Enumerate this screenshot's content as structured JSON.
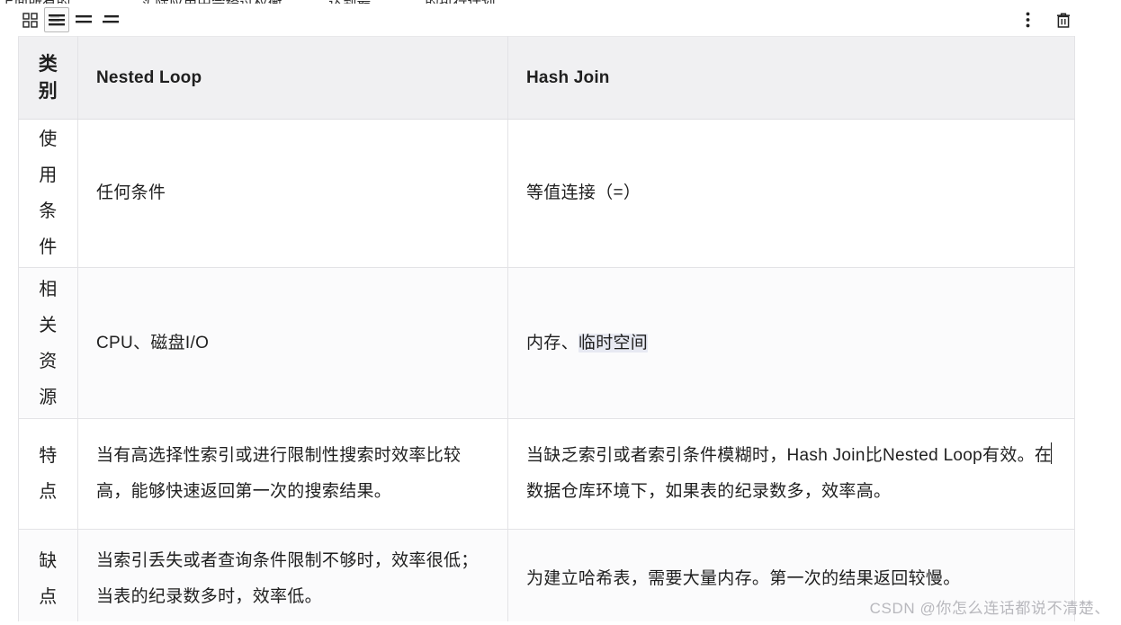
{
  "top_clipped_line": {
    "fragment_1": "上面所有的",
    "fragment_2": "实际应用中会经过权衡",
    "fragment_3": "，达到最",
    "fragment_4": "的执行计划。"
  },
  "toolbar": {
    "left_buttons": [
      {
        "name": "grid-view",
        "icon": "grid-icon",
        "active": false,
        "tooltip": "网格"
      },
      {
        "name": "align-left",
        "icon": "align-left-icon",
        "active": true,
        "tooltip": "左对齐"
      },
      {
        "name": "align-center",
        "icon": "align-center-icon",
        "active": false,
        "tooltip": "居中对齐"
      },
      {
        "name": "align-right",
        "icon": "align-right-icon",
        "active": false,
        "tooltip": "右对齐"
      }
    ],
    "right_buttons": [
      {
        "name": "more-options",
        "icon": "more-vertical-icon",
        "tooltip": "更多"
      },
      {
        "name": "delete",
        "icon": "trash-icon",
        "tooltip": "删除"
      }
    ]
  },
  "table": {
    "headers": {
      "category": "类别",
      "nested_loop": "Nested Loop",
      "hash_join": "Hash Join"
    },
    "rows": [
      {
        "category": "使用条件",
        "nested_loop": "任何条件",
        "hash_join": "等值连接（=）"
      },
      {
        "category": "相关资源",
        "nested_loop": "CPU、磁盘I/O",
        "hash_join_part1": "内存、",
        "hash_join_selected": "临时空间"
      },
      {
        "category": "特点",
        "nested_loop": "当有高选择性索引或进行限制性搜索时效率比较高，能够快速返回第一次的搜索结果。",
        "hash_join_part1": "当缺乏索引或者索引条件模糊时，Hash Join比Nested Loop有效。在",
        "hash_join_part2": "数据仓库环境下，如果表的纪录数多，效率高。"
      },
      {
        "category": "缺点",
        "nested_loop": "当索引丢失或者查询条件限制不够时，效率很低；当表的纪录数多时，效率低。",
        "hash_join": "为建立哈希表，需要大量内存。第一次的结果返回较慢。"
      }
    ]
  },
  "watermark": "CSDN @你怎么连话都说不清楚、",
  "colors": {
    "header_bg": "#f0f0f2",
    "border": "#e3e3e6",
    "text": "#1f1f1f",
    "watermark": "#b8b8bd",
    "selection": "#e7e9f2"
  }
}
